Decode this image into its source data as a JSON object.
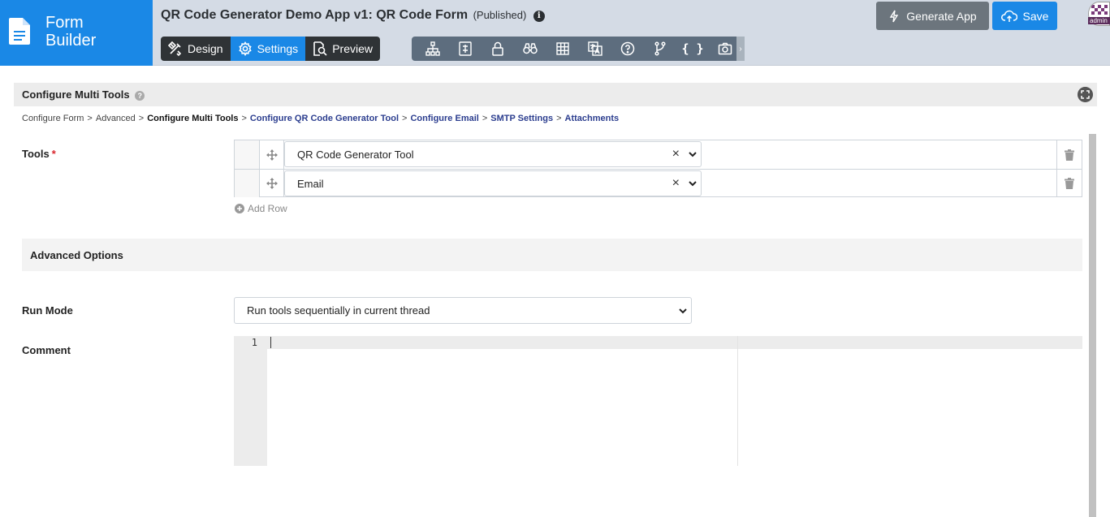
{
  "brand": {
    "line1": "Form",
    "line2": "Builder"
  },
  "header": {
    "title": "QR Code Generator Demo App v1: QR Code Form",
    "status": "(Published)",
    "info_glyph": "i",
    "mode_tabs": [
      {
        "label": "Design",
        "icon": "design-tools-icon",
        "active": false
      },
      {
        "label": "Settings",
        "icon": "gear-icon",
        "active": true
      },
      {
        "label": "Preview",
        "icon": "preview-search-icon",
        "active": false
      }
    ],
    "toolbar_icons": [
      "hierarchy-icon",
      "form-fields-icon",
      "lock-icon",
      "binoculars-icon",
      "table-grid-icon",
      "translate-icon",
      "help-circle-icon",
      "branch-icon",
      "braces-icon",
      "camera-icon"
    ],
    "toolbar_braces": "{ }",
    "more_glyph": "›",
    "generate_label": "Generate App",
    "save_label": "Save",
    "avatar_label": "admin"
  },
  "section": {
    "title": "Configure Multi Tools",
    "help_glyph": "?"
  },
  "breadcrumb": [
    {
      "label": "Configure Form",
      "type": "plain"
    },
    {
      "label": "Advanced",
      "type": "plain"
    },
    {
      "label": "Configure Multi Tools",
      "type": "current"
    },
    {
      "label": "Configure QR Code Generator Tool",
      "type": "link"
    },
    {
      "label": "Configure Email",
      "type": "link"
    },
    {
      "label": "SMTP Settings",
      "type": "link"
    },
    {
      "label": "Attachments",
      "type": "link"
    }
  ],
  "breadcrumb_sep": ">",
  "tools": {
    "label": "Tools",
    "required_mark": "*",
    "rows": [
      {
        "value": "QR Code Generator Tool"
      },
      {
        "value": "Email"
      }
    ],
    "clear_glyph": "×",
    "add_row_label": "Add Row"
  },
  "advanced": {
    "title": "Advanced Options"
  },
  "run_mode": {
    "label": "Run Mode",
    "value": "Run tools sequentially in current thread"
  },
  "comment": {
    "label": "Comment",
    "line_number": "1"
  },
  "colors": {
    "brand": "#1a88e6",
    "header_bg": "#d4dbe5",
    "dark_tab": "#2f3336",
    "toolbar": "#5d6d7e",
    "generate": "#6c757d",
    "required": "#d9252c",
    "link": "#2c3e8f"
  }
}
